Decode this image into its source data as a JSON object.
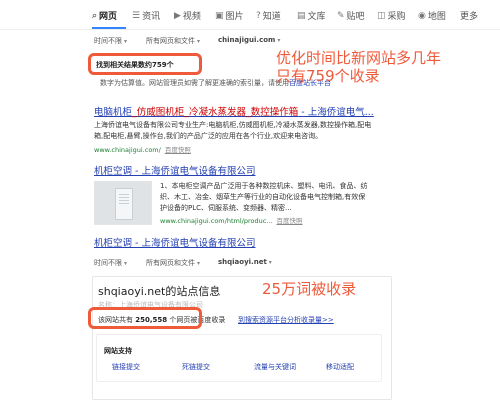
{
  "nav": {
    "items": [
      {
        "label": "网页",
        "icon": "search-icon",
        "glyph": "⌕"
      },
      {
        "label": "资讯",
        "icon": "news-icon",
        "glyph": "☰"
      },
      {
        "label": "视频",
        "icon": "video-icon",
        "glyph": "▶"
      },
      {
        "label": "图片",
        "icon": "image-icon",
        "glyph": "▣"
      },
      {
        "label": "知道",
        "icon": "question-icon",
        "glyph": "?"
      },
      {
        "label": "文库",
        "icon": "document-icon",
        "glyph": "▤"
      },
      {
        "label": "贴吧",
        "icon": "forum-icon",
        "glyph": "✎"
      },
      {
        "label": "采购",
        "icon": "shopping-icon",
        "glyph": "◫"
      },
      {
        "label": "地图",
        "icon": "map-pin-icon",
        "glyph": "◉"
      },
      {
        "label": "更多"
      }
    ]
  },
  "filters_top": {
    "time": "时间不限",
    "scope": "所有网页和文件",
    "site": "chinajigui.com"
  },
  "result_count": "找到相关结果数约759个",
  "estimate": {
    "text": "数字为估算值。网站管理员如需了解更准确的索引量，请使用",
    "link": "百度站长平台"
  },
  "annotations": {
    "top_line1": "优化时间比新网站多几年",
    "top_line2": "只有759个收录",
    "bottom": "25万词被收录"
  },
  "results": [
    {
      "title_pre": "电脑机柜",
      "title_hl": "_仿威图机柜_冷凝水蒸发器_数控操作箱",
      "title_post": " - 上海侨谊电气...",
      "snippet1": "上海侨谊电气设备有限公司专业生产:电脑机柜,仿威图机柜,冷凝水蒸发器,数控操作箱,配电",
      "snippet2": "箱,配电柜,悬臂,操作台,我们的产品广泛的应用在各个行业,欢迎来电咨询。",
      "url": "www.chinajigui.com/",
      "cache": "百度快照"
    },
    {
      "title": "机柜空调 - 上海侨谊电气设备有限公司",
      "snippet1": "1、本电柜空调产品广泛用于各种数控机床、塑料、电讯、食品、纺",
      "snippet2": "织、木工、冶金、烟草生产等行业的自动化设备电气控制箱,有效保",
      "snippet3": "护设备的PLC、伺服系统、变频器、精密...",
      "url": "www.chinajigui.com/html/produc...",
      "cache": "百度快照"
    },
    {
      "title": "机柜空调 - 上海侨谊电气设备有限公司"
    }
  ],
  "filters_bottom": {
    "time": "时间不限",
    "scope": "所有网页和文件",
    "site": "shqiaoyi.net"
  },
  "site_card": {
    "title": "shqiaoyi.net的站点信息",
    "subtitle": "名称：上海侨谊电气设备有限公司",
    "pages_pre": "该网站共有",
    "pages_num": "250,558",
    "pages_post": "个网页被百度收录",
    "pages_link": "到搜索资源平台分析收录量>>",
    "support_label": "网站支持",
    "chips": [
      "链接提交",
      "死链提交",
      "流量与关键词",
      "移动适配"
    ]
  }
}
